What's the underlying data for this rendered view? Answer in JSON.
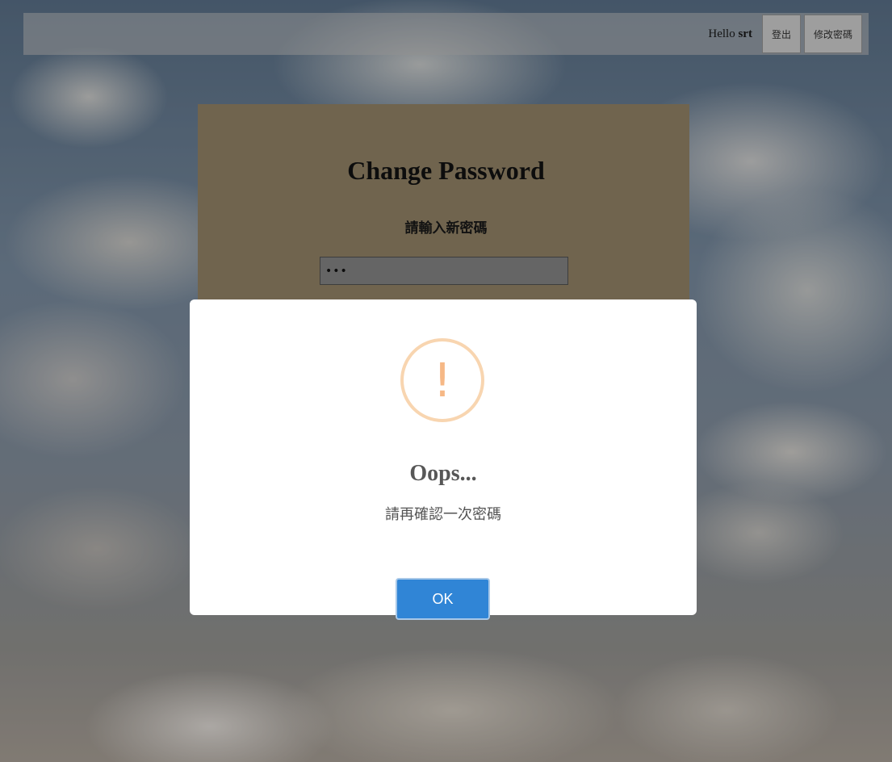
{
  "header": {
    "greeting_prefix": "Hello",
    "username": "srt",
    "logout_label": "登出",
    "change_password_label": "修改密碼"
  },
  "form": {
    "title": "Change Password",
    "new_password_label": "請輸入新密碼",
    "new_password_value": "•••"
  },
  "alert": {
    "icon": "warning-icon",
    "icon_glyph": "!",
    "title": "Oops...",
    "message": "請再確認一次密碼",
    "ok_label": "OK"
  },
  "colors": {
    "card_bg": "#9b8b6c",
    "ok_button": "#3085d6",
    "warning_accent": "#f6b886"
  }
}
